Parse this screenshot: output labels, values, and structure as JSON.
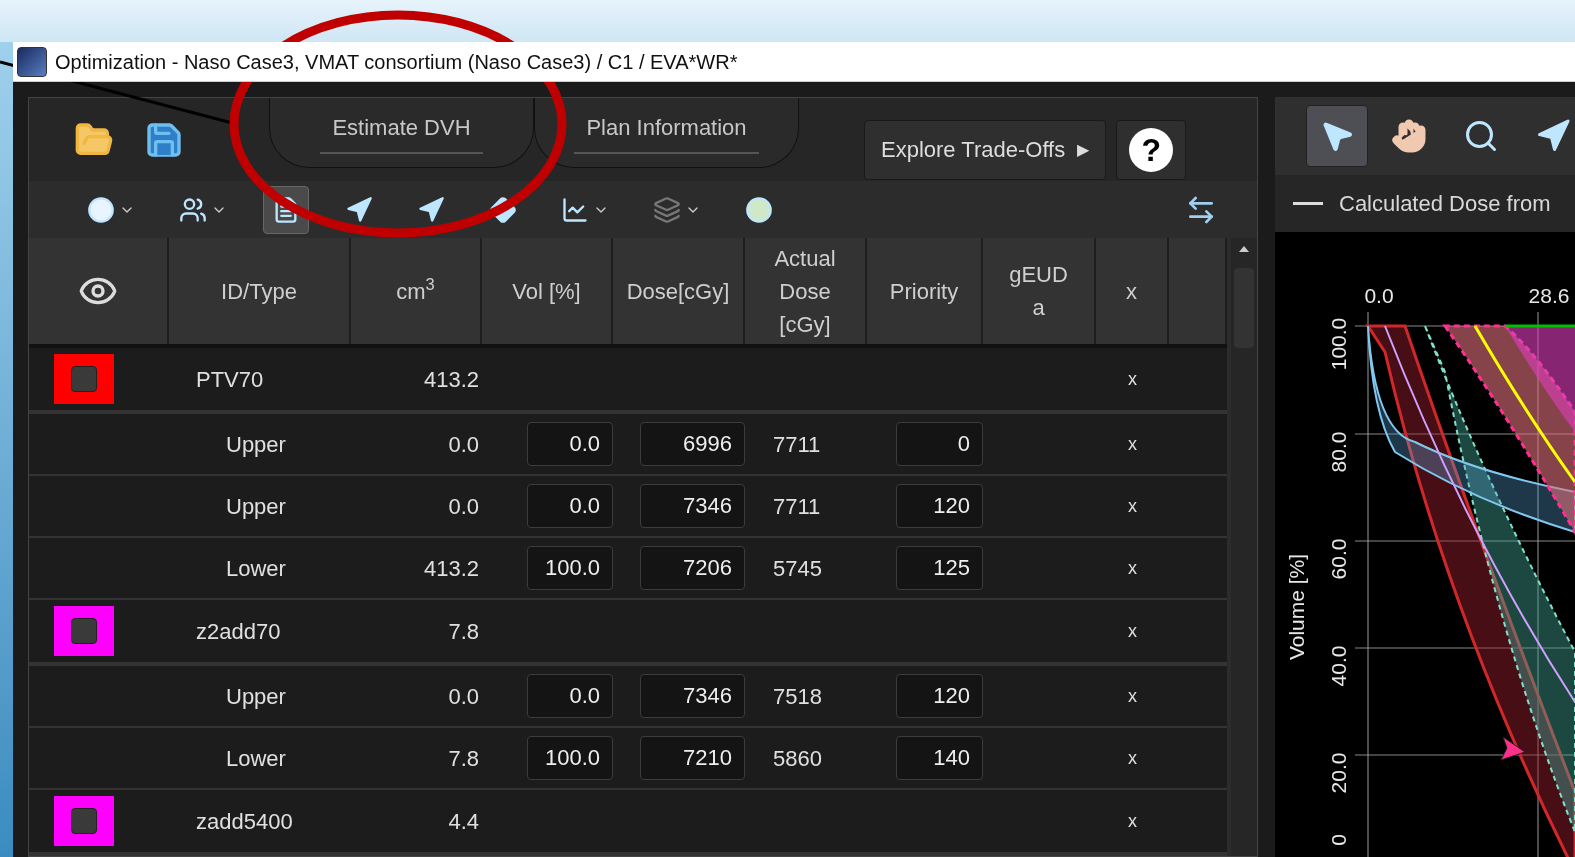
{
  "window": {
    "title": "Optimization - Naso Case3, VMAT consortium (Naso Case3) / C1 / EVA*WR*"
  },
  "tabs": [
    {
      "label": "Estimate DVH",
      "selected": false
    },
    {
      "label": "Plan Information",
      "selected": false
    }
  ],
  "explore_button": {
    "label": "Explore Trade-Offs",
    "arrow": "▶"
  },
  "help_button": {
    "label": "?"
  },
  "toolbar_tools": [
    {
      "kind": "blob",
      "selected": false
    },
    {
      "kind": "finder",
      "selected": false
    },
    {
      "kind": "page",
      "selected": true
    },
    {
      "kind": "arrow",
      "selected": false
    },
    {
      "kind": "arrow",
      "selected": false
    },
    {
      "kind": "diamond",
      "selected": false
    },
    {
      "kind": "curve",
      "selected": false
    },
    {
      "kind": "stack",
      "selected": false
    },
    {
      "kind": "sphere",
      "selected": false
    }
  ],
  "table": {
    "columns": [
      {
        "kind": "eye"
      },
      {
        "lines": [
          "ID/Type"
        ]
      },
      {
        "lines": [
          "cm$^{3}$"
        ]
      },
      {
        "lines": [
          "Vol [%]"
        ]
      },
      {
        "lines": [
          "Dose[cGy]"
        ]
      },
      {
        "lines": [
          "Actual",
          "Dose",
          "[cGy]"
        ]
      },
      {
        "lines": [
          "Priority"
        ]
      },
      {
        "lines": [
          "gEUD",
          "a"
        ]
      },
      {
        "lines": [
          "x"
        ]
      },
      {
        "kind": "blank"
      }
    ],
    "rows": [
      {
        "kind": "structure",
        "id": "PTV70",
        "color": "#ff0000",
        "cm3": "413.2",
        "remove": "x"
      },
      {
        "kind": "constraint",
        "type": "Upper",
        "cm3": "0.0",
        "vol": "0.0",
        "dose": "6996",
        "actual": "7711",
        "priority": "0",
        "remove": "x"
      },
      {
        "kind": "constraint",
        "type": "Upper",
        "cm3": "0.0",
        "vol": "0.0",
        "dose": "7346",
        "actual": "7711",
        "priority": "120",
        "remove": "x"
      },
      {
        "kind": "constraint",
        "type": "Lower",
        "cm3": "413.2",
        "vol": "100.0",
        "dose": "7206",
        "actual": "5745",
        "priority": "125",
        "remove": "x"
      },
      {
        "kind": "structure",
        "id": "z2add70",
        "color": "#ff00ff",
        "cm3": "7.8",
        "remove": "x"
      },
      {
        "kind": "constraint",
        "type": "Upper",
        "cm3": "0.0",
        "vol": "0.0",
        "dose": "7346",
        "actual": "7518",
        "priority": "120",
        "remove": "x"
      },
      {
        "kind": "constraint",
        "type": "Lower",
        "cm3": "7.8",
        "vol": "100.0",
        "dose": "7210",
        "actual": "5860",
        "priority": "140",
        "remove": "x"
      },
      {
        "kind": "structure",
        "id": "zadd5400",
        "color": "#ff00ff",
        "cm3": "4.4",
        "remove": "x"
      }
    ]
  },
  "view_tools": [
    {
      "kind": "pointer",
      "selected": true
    },
    {
      "kind": "hand",
      "selected": false
    },
    {
      "kind": "zoom",
      "selected": false
    },
    {
      "kind": "arrow",
      "selected": false
    }
  ],
  "legend": {
    "label": "Calculated Dose from"
  },
  "dvh_plot": {
    "ylabel": "Volume [%]",
    "x_ticks": [
      "0.0",
      "28.6"
    ],
    "y_ticks": [
      "100.0",
      "80.0",
      "60.0",
      "40.0",
      "20.0",
      "0"
    ]
  }
}
